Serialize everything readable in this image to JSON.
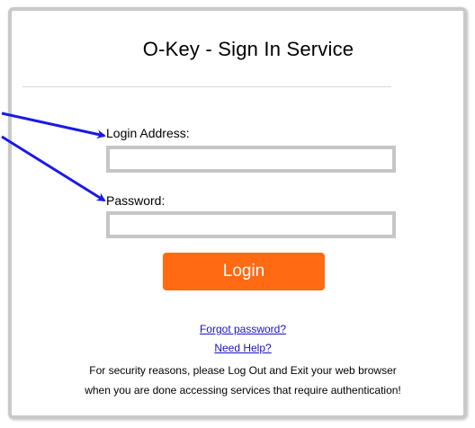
{
  "page": {
    "title": "O-Key - Sign In Service"
  },
  "form": {
    "login_label": "Login Address:",
    "login_value": "",
    "password_label": "Password:",
    "password_value": "",
    "login_button": "Login"
  },
  "links": {
    "forgot_password": "Forgot password?",
    "need_help": "Need Help?"
  },
  "notice": {
    "line1": "For security reasons, please Log Out and Exit your web browser",
    "line2": "when you are done accessing services that require authentication!"
  },
  "annotations": {
    "arrow_color": "#1a1ae6",
    "arrows": [
      "arrow-to-login-address",
      "arrow-to-password"
    ]
  },
  "colors": {
    "button_bg": "#ff6a13",
    "link": "#1a13c8",
    "panel_border": "#c9c9c9",
    "input_border": "#c6c6c6"
  }
}
